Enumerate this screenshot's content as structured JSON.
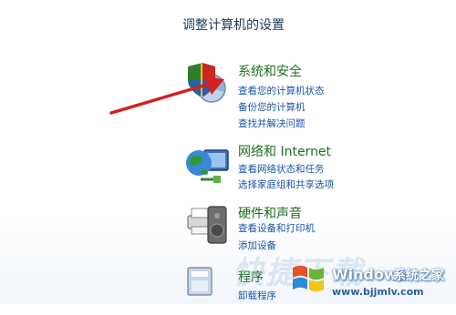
{
  "heading": "调整计算机的设置",
  "sections": [
    {
      "title": "系统和安全",
      "icon": "shield-pie-chart-icon",
      "links": [
        "查看您的计算机状态",
        "备份您的计算机",
        "查找并解决问题"
      ]
    },
    {
      "title": "网络和 Internet",
      "icon": "network-globe-icon",
      "links": [
        "查看网络状态和任务",
        "选择家庭组和共享选项"
      ]
    },
    {
      "title": "硬件和声音",
      "icon": "printer-speaker-icon",
      "links": [
        "查看设备和打印机",
        "添加设备"
      ]
    },
    {
      "title": "程序",
      "icon": "programs-icon",
      "links": [
        "卸载程序"
      ]
    }
  ],
  "watermark": {
    "brand": "Windows",
    "site": "系统之家",
    "url": "www.bjjmlv.com",
    "faint_text": "快捷下载",
    "icon": "windows-logo-icon"
  },
  "annotation": {
    "icon": "red-arrow-icon",
    "color": "#d42020"
  },
  "colors": {
    "title_green": "#1f6e1f",
    "link_blue": "#1a55a6",
    "heading": "#1e3a5a"
  }
}
